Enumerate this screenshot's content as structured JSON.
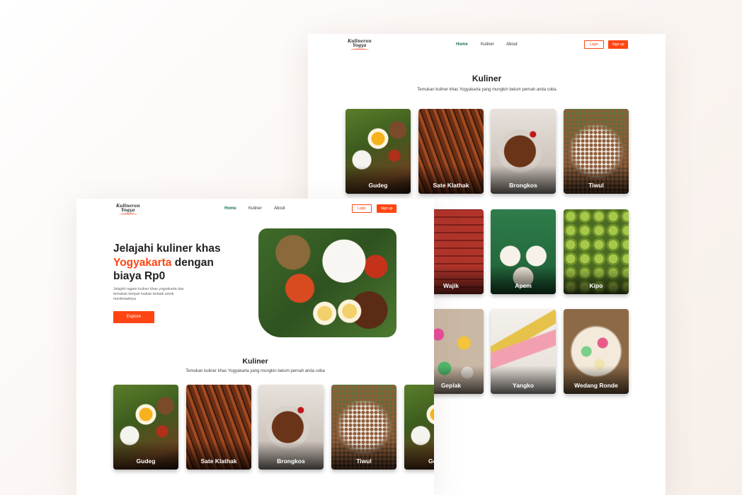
{
  "brand": {
    "line1": "Kulineran",
    "line2": "Yogya"
  },
  "nav": {
    "home": "Home",
    "kuliner": "Kuliner",
    "about": "About",
    "login": "Login",
    "signup": "Sign up"
  },
  "hero": {
    "title_part1": "Jelajahi kuliner khas",
    "title_accent": "Yogyakarta",
    "title_part2": "dengan biaya Rp0",
    "description": "Jelajahi ragam kuliner khas yogyakarta dan temukan tempat makan terbaik untuk menikmatinya",
    "explore_label": "Explore"
  },
  "kuliner_section": {
    "title": "Kuliner",
    "subtitle": "Temukan kuliner khas Yogyakarta yang mungkin belum pernah anda coba"
  },
  "foods": [
    "Gudeg",
    "Sate Klathak",
    "Brongkos",
    "Tiwul",
    "Wajik",
    "Apem",
    "Kipo",
    "Geplak",
    "Yangko",
    "Wedang Ronde",
    "Ge"
  ]
}
